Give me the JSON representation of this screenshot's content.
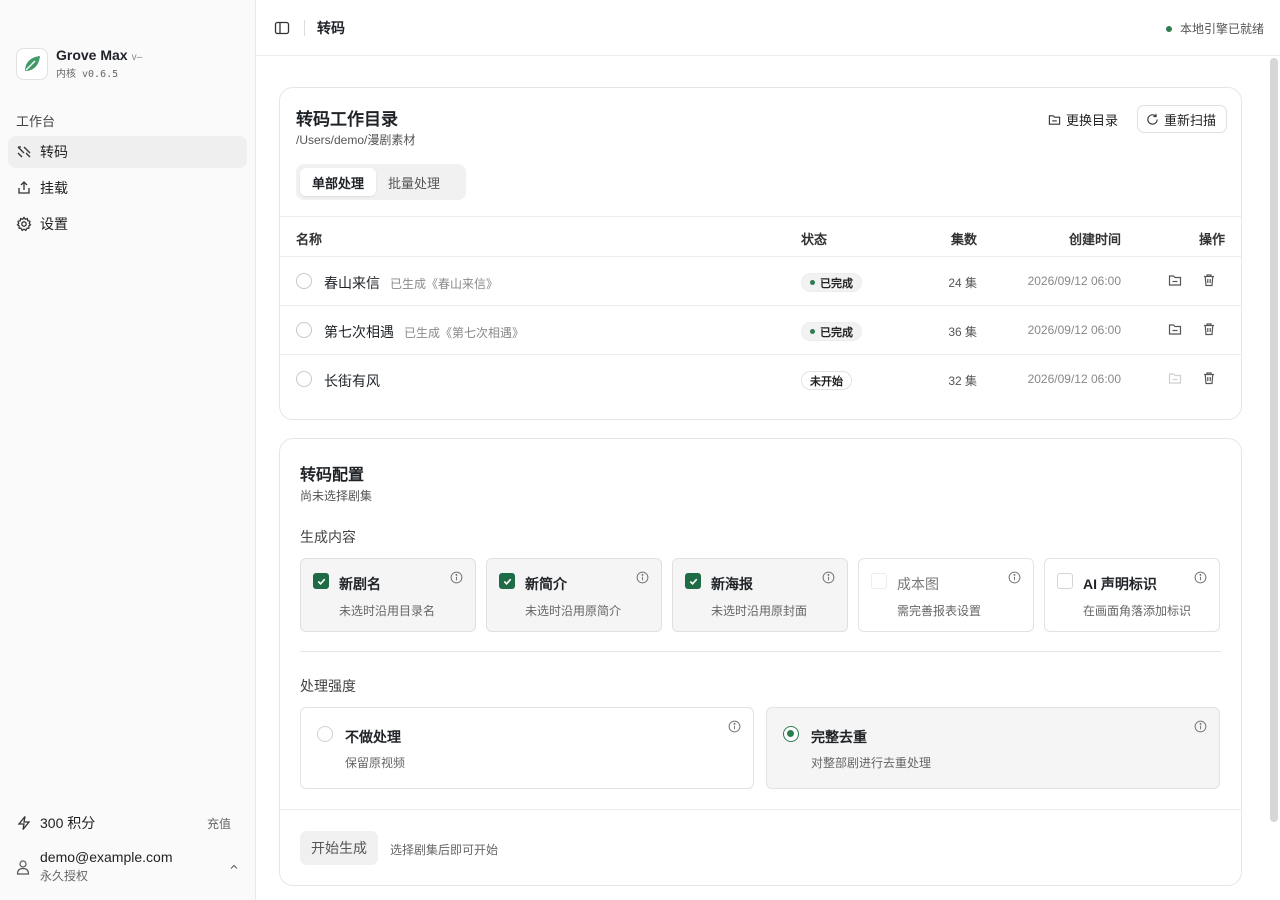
{
  "app": {
    "name": "Grove Max",
    "version_tag": "v–",
    "kernel": "内核 v0.6.5"
  },
  "sidebar": {
    "section_label": "工作台",
    "items": [
      {
        "label": "转码",
        "icon": "transcode-icon",
        "active": true
      },
      {
        "label": "挂载",
        "icon": "upload-icon",
        "active": false
      },
      {
        "label": "设置",
        "icon": "gear-icon",
        "active": false
      }
    ],
    "points": {
      "label": "300 积分",
      "recharge": "充值"
    },
    "account": {
      "email": "demo@example.com",
      "license": "永久授权"
    }
  },
  "topbar": {
    "title": "转码",
    "engine_status": "本地引擎已就绪",
    "status_color": "#2e7d4f"
  },
  "directory": {
    "title": "转码工作目录",
    "path": "/Users/demo/漫剧素材",
    "change_label": "更换目录",
    "rescan_label": "重新扫描",
    "tabs": [
      {
        "label": "单部处理",
        "active": true
      },
      {
        "label": "批量处理",
        "active": false
      }
    ],
    "columns": {
      "name": "名称",
      "status": "状态",
      "episodes": "集数",
      "created": "创建时间",
      "actions": "操作"
    },
    "rows": [
      {
        "name": "春山来信",
        "sub": "已生成《春山来信》",
        "status": "已完成",
        "done": true,
        "episodes": "24 集",
        "created": "2026/09/12 06:00"
      },
      {
        "name": "第七次相遇",
        "sub": "已生成《第七次相遇》",
        "status": "已完成",
        "done": true,
        "episodes": "36 集",
        "created": "2026/09/12 06:00"
      },
      {
        "name": "长街有风",
        "sub": "",
        "status": "未开始",
        "done": false,
        "episodes": "32 集",
        "created": "2026/09/12 06:00"
      }
    ]
  },
  "config": {
    "title": "转码配置",
    "subtitle": "尚未选择剧集",
    "content_label": "生成内容",
    "options": [
      {
        "title": "新剧名",
        "desc": "未选时沿用目录名",
        "checked": true,
        "disabled": false
      },
      {
        "title": "新简介",
        "desc": "未选时沿用原简介",
        "checked": true,
        "disabled": false
      },
      {
        "title": "新海报",
        "desc": "未选时沿用原封面",
        "checked": true,
        "disabled": false
      },
      {
        "title": "成本图",
        "desc": "需完善报表设置",
        "checked": false,
        "disabled": true
      },
      {
        "title": "AI 声明标识",
        "desc": "在画面角落添加标识",
        "checked": false,
        "disabled": false
      }
    ],
    "intensity_label": "处理强度",
    "intensity": [
      {
        "title": "不做处理",
        "desc": "保留原视频",
        "selected": false
      },
      {
        "title": "完整去重",
        "desc": "对整部剧进行去重处理",
        "selected": true
      }
    ],
    "start_label": "开始生成",
    "start_hint": "选择剧集后即可开始"
  },
  "colors": {
    "accent": "#1f6b46",
    "status_green": "#2e7d4f"
  }
}
